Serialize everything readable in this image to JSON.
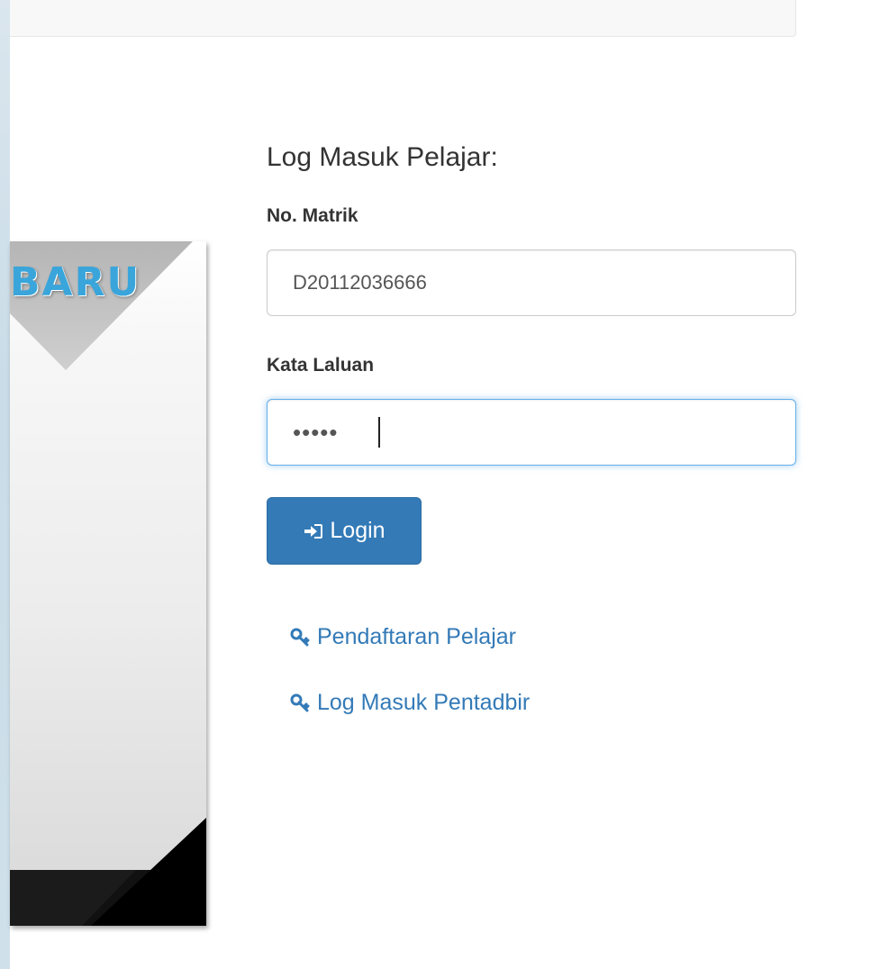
{
  "banner": {
    "word": "BARU"
  },
  "login": {
    "title": "Log Masuk Pelajar:",
    "matrik_label": "No. Matrik",
    "matrik_value": "D20112036666",
    "password_label": "Kata Laluan",
    "password_value": "•••••",
    "button_label": "Login",
    "button_icon": "log-in-icon"
  },
  "links": {
    "register": {
      "label": "Pendaftaran Pelajar",
      "icon": "key-icon"
    },
    "admin": {
      "label": "Log Masuk Pentadbir",
      "icon": "key-icon"
    }
  },
  "colors": {
    "primary": "#337ab7",
    "focus_border": "#66afe9",
    "banner_text": "#3aa5da"
  }
}
